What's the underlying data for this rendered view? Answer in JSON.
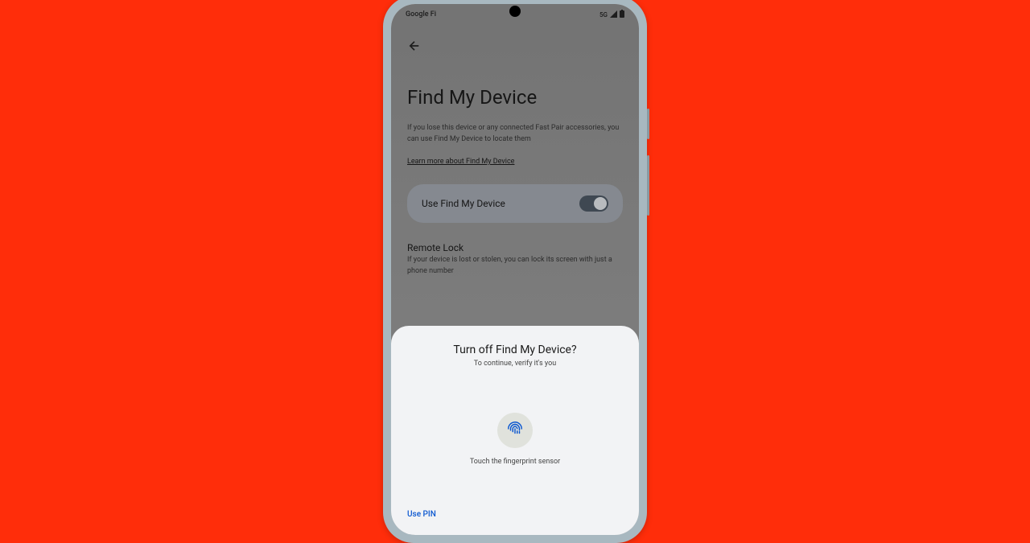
{
  "status_bar": {
    "carrier": "Google Fi",
    "network": "5G"
  },
  "page": {
    "title": "Find My Device",
    "description": "If you lose this device or any connected Fast Pair accessories, you can use Find My Device to locate them",
    "learn_more": "Learn more about Find My Device",
    "toggle_label": "Use Find My Device",
    "section_title": "Remote Lock",
    "section_desc": "If your device is lost or stolen, you can lock its screen with just a phone number"
  },
  "dialog": {
    "title": "Turn off Find My Device?",
    "subtitle": "To continue, verify it's you",
    "hint": "Touch the fingerprint sensor",
    "use_pin": "Use PIN"
  }
}
